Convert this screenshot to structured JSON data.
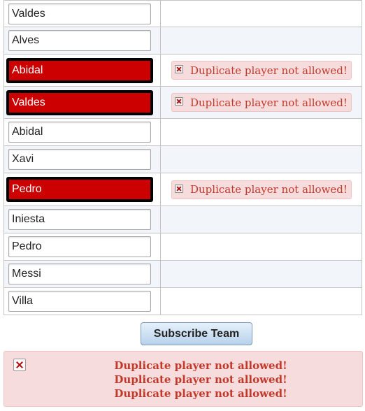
{
  "players": [
    {
      "value": "Valdes",
      "error": false
    },
    {
      "value": "Alves",
      "error": false
    },
    {
      "value": "Abidal",
      "error": true,
      "message": "Duplicate player not allowed!"
    },
    {
      "value": "Valdes",
      "error": true,
      "message": "Duplicate player not allowed!"
    },
    {
      "value": "Abidal",
      "error": false
    },
    {
      "value": "Xavi",
      "error": false
    },
    {
      "value": "Pedro",
      "error": true,
      "message": "Duplicate player not allowed!"
    },
    {
      "value": "Iniesta",
      "error": false
    },
    {
      "value": "Pedro",
      "error": false
    },
    {
      "value": "Messi",
      "error": false
    },
    {
      "value": "Villa",
      "error": false
    }
  ],
  "submit_label": "Subscribe Team",
  "summary": {
    "icon": "error-icon",
    "messages": [
      "Duplicate player not allowed!",
      "Duplicate player not allowed!",
      "Duplicate player not allowed!"
    ]
  },
  "colors": {
    "error_fill": "#cc0000",
    "message_text": "#c0392b",
    "message_bg": "#f6dcdc",
    "alt_row": "#f2f5f9"
  }
}
